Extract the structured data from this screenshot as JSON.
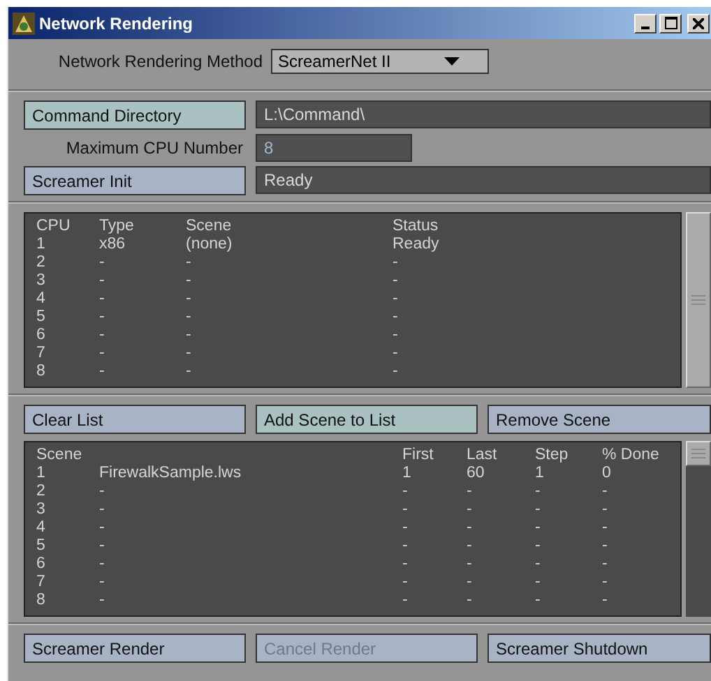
{
  "window": {
    "title": "Network Rendering"
  },
  "method": {
    "label": "Network Rendering Method",
    "value": "ScreamerNet II"
  },
  "settings": [
    {
      "kind": "button",
      "label": "Command Directory",
      "accent": true,
      "value": "L:\\Command\\"
    },
    {
      "kind": "label",
      "label": "Maximum CPU Number",
      "value": "8"
    },
    {
      "kind": "button",
      "label": "Screamer Init",
      "accent": false,
      "value": "Ready"
    }
  ],
  "cpu_list": {
    "columns": [
      "CPU",
      "Type",
      "Scene",
      "Status"
    ],
    "rows": [
      [
        "1",
        "x86",
        "(none)",
        "Ready"
      ],
      [
        "2",
        "-",
        "-",
        "-"
      ],
      [
        "3",
        "-",
        "-",
        "-"
      ],
      [
        "4",
        "-",
        "-",
        "-"
      ],
      [
        "5",
        "-",
        "-",
        "-"
      ],
      [
        "6",
        "-",
        "-",
        "-"
      ],
      [
        "7",
        "-",
        "-",
        "-"
      ],
      [
        "8",
        "-",
        "-",
        "-"
      ]
    ]
  },
  "list_buttons": [
    {
      "label": "Clear List",
      "accent": false,
      "disabled": false
    },
    {
      "label": "Add Scene to List",
      "accent": true,
      "disabled": false
    },
    {
      "label": "Remove Scene",
      "accent": false,
      "disabled": false
    }
  ],
  "scene_list": {
    "columns": [
      "Scene",
      "First",
      "Last",
      "Step",
      "% Done"
    ],
    "rows": [
      {
        "number": "1",
        "file": "FirewalkSample.lws",
        "first": "1",
        "last": "60",
        "step": "1",
        "done": "0"
      },
      {
        "number": "2",
        "file": "-",
        "first": "-",
        "last": "-",
        "step": "-",
        "done": "-"
      },
      {
        "number": "3",
        "file": "-",
        "first": "-",
        "last": "-",
        "step": "-",
        "done": "-"
      },
      {
        "number": "4",
        "file": "-",
        "first": "-",
        "last": "-",
        "step": "-",
        "done": "-"
      },
      {
        "number": "5",
        "file": "-",
        "first": "-",
        "last": "-",
        "step": "-",
        "done": "-"
      },
      {
        "number": "6",
        "file": "-",
        "first": "-",
        "last": "-",
        "step": "-",
        "done": "-"
      },
      {
        "number": "7",
        "file": "-",
        "first": "-",
        "last": "-",
        "step": "-",
        "done": "-"
      },
      {
        "number": "8",
        "file": "-",
        "first": "-",
        "last": "-",
        "step": "-",
        "done": "-"
      }
    ]
  },
  "bottom_buttons": [
    {
      "label": "Screamer Render",
      "accent": false,
      "disabled": false
    },
    {
      "label": "Cancel Render",
      "accent": false,
      "disabled": true
    },
    {
      "label": "Screamer Shutdown",
      "accent": false,
      "disabled": false
    }
  ]
}
